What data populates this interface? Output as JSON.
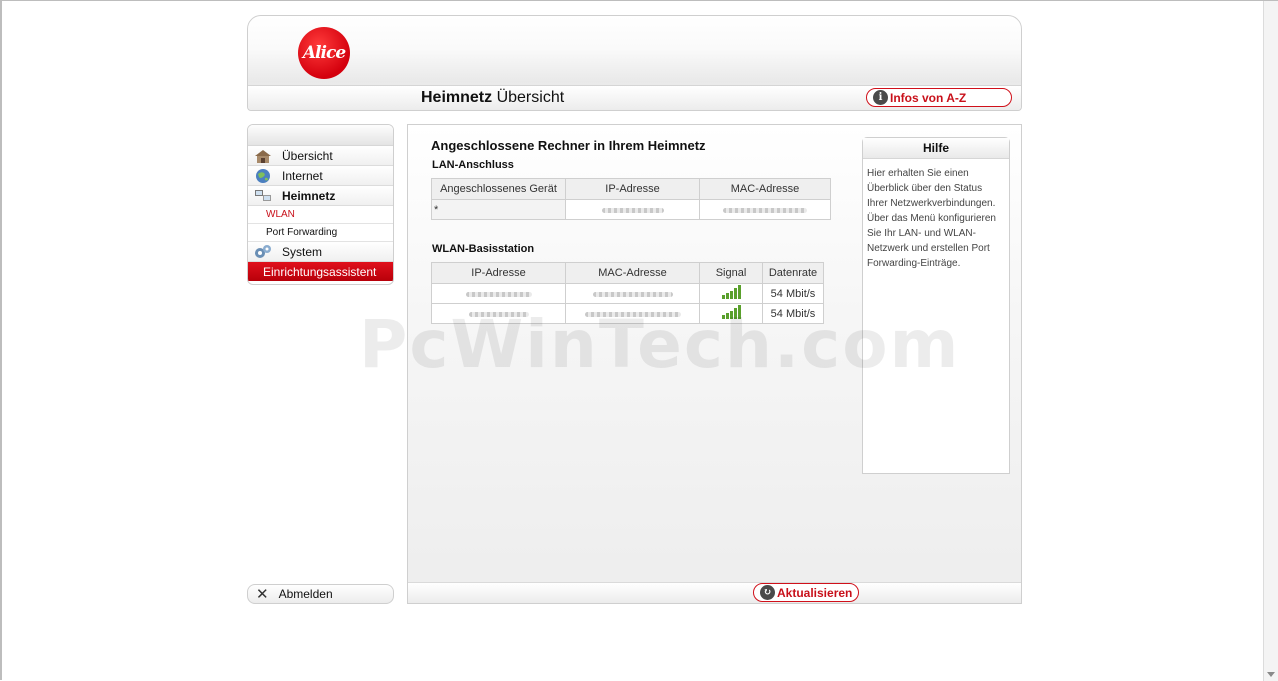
{
  "header": {
    "logo_text": "Alice",
    "title_bold": "Heimnetz",
    "title_rest": "Übersicht",
    "infos_button": "Infos von A-Z"
  },
  "sidebar": {
    "items": [
      {
        "label": "Übersicht",
        "icon": "house-icon"
      },
      {
        "label": "Internet",
        "icon": "globe-icon"
      },
      {
        "label": "Heimnetz",
        "icon": "network-computers-icon"
      }
    ],
    "sub_items": [
      {
        "label": "WLAN"
      },
      {
        "label": "Port Forwarding"
      }
    ],
    "system": {
      "label": "System",
      "icon": "gears-icon"
    },
    "wizard": "Einrichtungsassistent",
    "logout": "Abmelden"
  },
  "main": {
    "heading": "Angeschlossene Rechner in Ihrem Heimnetz",
    "lan": {
      "title": "LAN-Anschluss",
      "columns": [
        "Angeschlossenes Gerät",
        "IP-Adresse",
        "MAC-Adresse"
      ],
      "rows": [
        {
          "device": "*",
          "ip": "",
          "mac": ""
        }
      ]
    },
    "wlan": {
      "title": "WLAN-Basisstation",
      "columns": [
        "IP-Adresse",
        "MAC-Adresse",
        "Signal",
        "Datenrate"
      ],
      "rows": [
        {
          "ip": "",
          "mac": "",
          "signal": "5",
          "rate": "54 Mbit/s"
        },
        {
          "ip": "",
          "mac": "",
          "signal": "5",
          "rate": "54 Mbit/s"
        }
      ]
    },
    "refresh_button": "Aktualisieren"
  },
  "help": {
    "title": "Hilfe",
    "text": "Hier erhalten Sie einen Überblick über den Status Ihrer Netzwerkverbindungen. Über das Menü konfigurieren Sie Ihr LAN- und WLAN-Netzwerk und erstellen Port Forwarding-Einträge."
  },
  "watermark": "PcWinTech.com",
  "colors": {
    "accent": "#c8101a",
    "signal": "#5aa02c"
  }
}
